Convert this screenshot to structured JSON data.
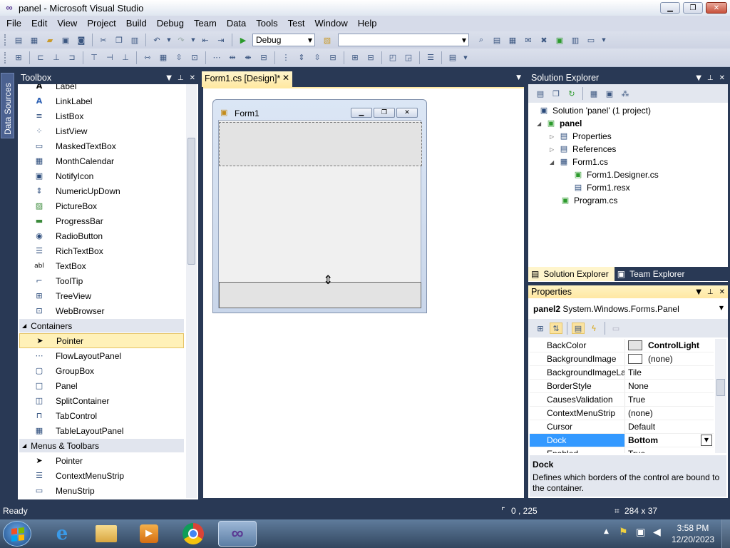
{
  "window": {
    "title": "panel - Microsoft Visual Studio",
    "min_label": "▁",
    "max_label": "❐",
    "close_label": "✕"
  },
  "menu": [
    {
      "label": "File"
    },
    {
      "label": "Edit"
    },
    {
      "label": "View"
    },
    {
      "label": "Project"
    },
    {
      "label": "Build"
    },
    {
      "label": "Debug"
    },
    {
      "label": "Team"
    },
    {
      "label": "Data"
    },
    {
      "label": "Tools"
    },
    {
      "label": "Test"
    },
    {
      "label": "Window"
    },
    {
      "label": "Help"
    }
  ],
  "toolbar": {
    "config_value": "Debug",
    "platform_value": ""
  },
  "left_strip": {
    "data_sources_label": "Data Sources"
  },
  "toolbox": {
    "title": "Toolbox",
    "items_top": [
      {
        "label": "Label",
        "icon": "A"
      },
      {
        "label": "LinkLabel",
        "icon": "A"
      },
      {
        "label": "ListBox",
        "icon": "≡"
      },
      {
        "label": "ListView",
        "icon": "⁘"
      },
      {
        "label": "MaskedTextBox",
        "icon": "▭"
      },
      {
        "label": "MonthCalendar",
        "icon": "▦"
      },
      {
        "label": "NotifyIcon",
        "icon": "▣"
      },
      {
        "label": "NumericUpDown",
        "icon": "⇕"
      },
      {
        "label": "PictureBox",
        "icon": "▨"
      },
      {
        "label": "ProgressBar",
        "icon": "▬"
      },
      {
        "label": "RadioButton",
        "icon": "◉"
      },
      {
        "label": "RichTextBox",
        "icon": "☰"
      },
      {
        "label": "TextBox",
        "icon": "abl"
      },
      {
        "label": "ToolTip",
        "icon": "⌐"
      },
      {
        "label": "TreeView",
        "icon": "⊞"
      },
      {
        "label": "WebBrowser",
        "icon": "⊡"
      }
    ],
    "cat_containers": "Containers",
    "items_containers": [
      {
        "label": "Pointer",
        "icon": "➤"
      },
      {
        "label": "FlowLayoutPanel",
        "icon": "⋯"
      },
      {
        "label": "GroupBox",
        "icon": "▢"
      },
      {
        "label": "Panel",
        "icon": "□"
      },
      {
        "label": "SplitContainer",
        "icon": "◫"
      },
      {
        "label": "TabControl",
        "icon": "⊓"
      },
      {
        "label": "TableLayoutPanel",
        "icon": "▦"
      }
    ],
    "cat_menus": "Menus & Toolbars",
    "items_menus": [
      {
        "label": "Pointer",
        "icon": "➤"
      },
      {
        "label": "ContextMenuStrip",
        "icon": "☰"
      },
      {
        "label": "MenuStrip",
        "icon": "▭"
      }
    ]
  },
  "document": {
    "tab_label": "Form1.cs [Design]*",
    "form_title": "Form1"
  },
  "solution_explorer": {
    "title": "Solution Explorer",
    "tree": [
      {
        "label": "Solution 'panel' (1 project)"
      },
      {
        "label": "panel"
      },
      {
        "label": "Properties"
      },
      {
        "label": "References"
      },
      {
        "label": "Form1.cs"
      },
      {
        "label": "Form1.Designer.cs"
      },
      {
        "label": "Form1.resx"
      },
      {
        "label": "Program.cs"
      }
    ],
    "tab_solution": "Solution Explorer",
    "tab_team": "Team Explorer"
  },
  "properties": {
    "title": "Properties",
    "object_name": "panel2",
    "object_type": "System.Windows.Forms.Panel",
    "rows": [
      {
        "name": "BackColor",
        "value": "ControlLight",
        "swatch": "#e3e3e3"
      },
      {
        "name": "BackgroundImage",
        "value": "(none)",
        "swatch": "#ffffff"
      },
      {
        "name": "BackgroundImageLayout",
        "value": "Tile"
      },
      {
        "name": "BorderStyle",
        "value": "None"
      },
      {
        "name": "CausesValidation",
        "value": "True"
      },
      {
        "name": "ContextMenuStrip",
        "value": "(none)"
      },
      {
        "name": "Cursor",
        "value": "Default"
      },
      {
        "name": "Dock",
        "value": "Bottom"
      },
      {
        "name": "Enabled",
        "value": "True"
      }
    ],
    "desc_title": "Dock",
    "desc_text": "Defines which borders of the control are bound to the container."
  },
  "status": {
    "ready": "Ready",
    "position": "0 , 225",
    "size": "284 x 37"
  },
  "taskbar": {
    "time": "3:58 PM",
    "date": "12/20/2023"
  },
  "colors": {
    "accent_highlight": "#fff1b8",
    "selection": "#3399ff",
    "chrome_dark": "#293955"
  }
}
